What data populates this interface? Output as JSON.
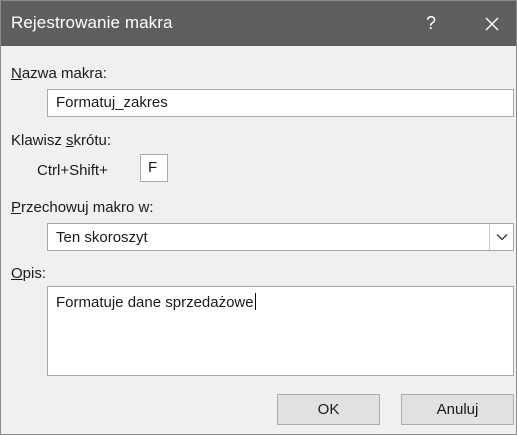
{
  "dialog": {
    "title": "Rejestrowanie makra",
    "help_label": "?",
    "icons": {
      "close": "close-icon",
      "dropdown": "chevron-down-icon"
    }
  },
  "macro_name": {
    "label_accel": "N",
    "label_rest": "azwa makra:",
    "value": "Formatuj_zakres"
  },
  "shortcut": {
    "label_pre": "Klawisz ",
    "label_accel": "s",
    "label_post": "krótu:",
    "prefix": "Ctrl+Shift+",
    "key_value": "F"
  },
  "store_in": {
    "label_accel": "P",
    "label_rest": "rzechowuj makro w:",
    "selected": "Ten skoroszyt"
  },
  "description": {
    "label_accel": "O",
    "label_rest": "pis:",
    "value": "Formatuje dane sprzedażowe"
  },
  "buttons": {
    "ok": "OK",
    "cancel": "Anuluj"
  },
  "colors": {
    "titlebar": "#5e5e5e",
    "dialog_bg": "#f0f0f0",
    "field_bg": "#ffffff",
    "button_bg": "#e1e1e1"
  }
}
